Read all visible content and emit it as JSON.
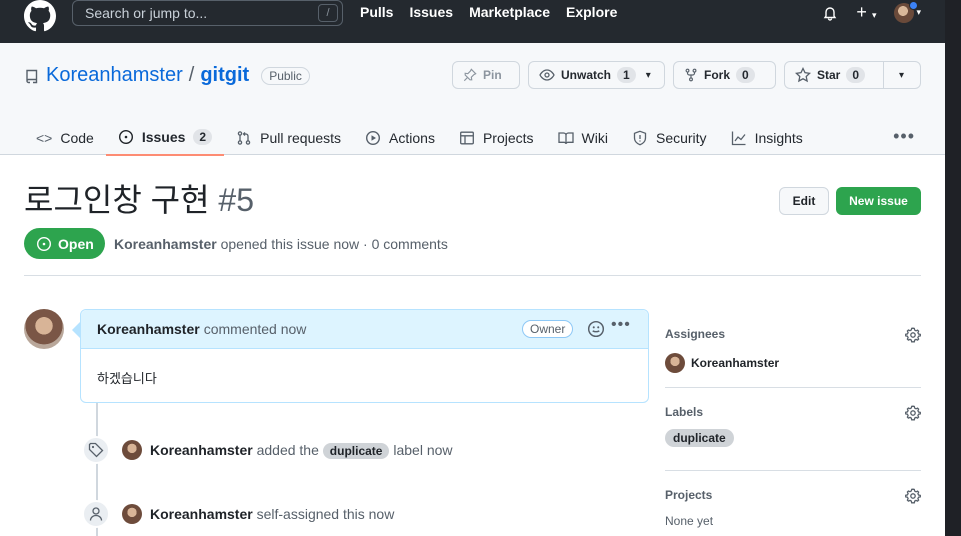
{
  "header": {
    "search_placeholder": "Search or jump to...",
    "search_shortcut": "/",
    "nav": [
      "Pulls",
      "Issues",
      "Marketplace",
      "Explore"
    ],
    "plus": "+"
  },
  "repo": {
    "owner": "Koreanhamster",
    "separator": "/",
    "name": "gitgit",
    "visibility": "Public",
    "pin_label": "Pin",
    "watch_label": "Unwatch",
    "watch_count": "1",
    "fork_label": "Fork",
    "fork_count": "0",
    "star_label": "Star",
    "star_count": "0"
  },
  "tabs": [
    {
      "label": "Code"
    },
    {
      "label": "Issues",
      "count": "2"
    },
    {
      "label": "Pull requests"
    },
    {
      "label": "Actions"
    },
    {
      "label": "Projects"
    },
    {
      "label": "Wiki"
    },
    {
      "label": "Security"
    },
    {
      "label": "Insights"
    }
  ],
  "issue": {
    "title": "로그인창 구현",
    "number": "#5",
    "edit_label": "Edit",
    "new_issue_label": "New issue",
    "state": "Open",
    "author": "Koreanhamster",
    "meta_rest": "opened this issue now · 0 comments"
  },
  "comment": {
    "author": "Koreanhamster",
    "action": "commented now",
    "badge": "Owner",
    "body": "하겠습니다"
  },
  "events": [
    {
      "author": "Koreanhamster",
      "pre": "added the",
      "label": "duplicate",
      "post": "label now"
    },
    {
      "author": "Koreanhamster",
      "text": "self-assigned this now"
    }
  ],
  "sidebar": {
    "assignees_title": "Assignees",
    "assignee": "Koreanhamster",
    "labels_title": "Labels",
    "label": "duplicate",
    "projects_title": "Projects",
    "projects_value": "None yet"
  },
  "colors": {
    "header_bg": "#24292f",
    "green": "#2da44e",
    "link": "#0969da",
    "tab_underline": "#fd8c73"
  }
}
